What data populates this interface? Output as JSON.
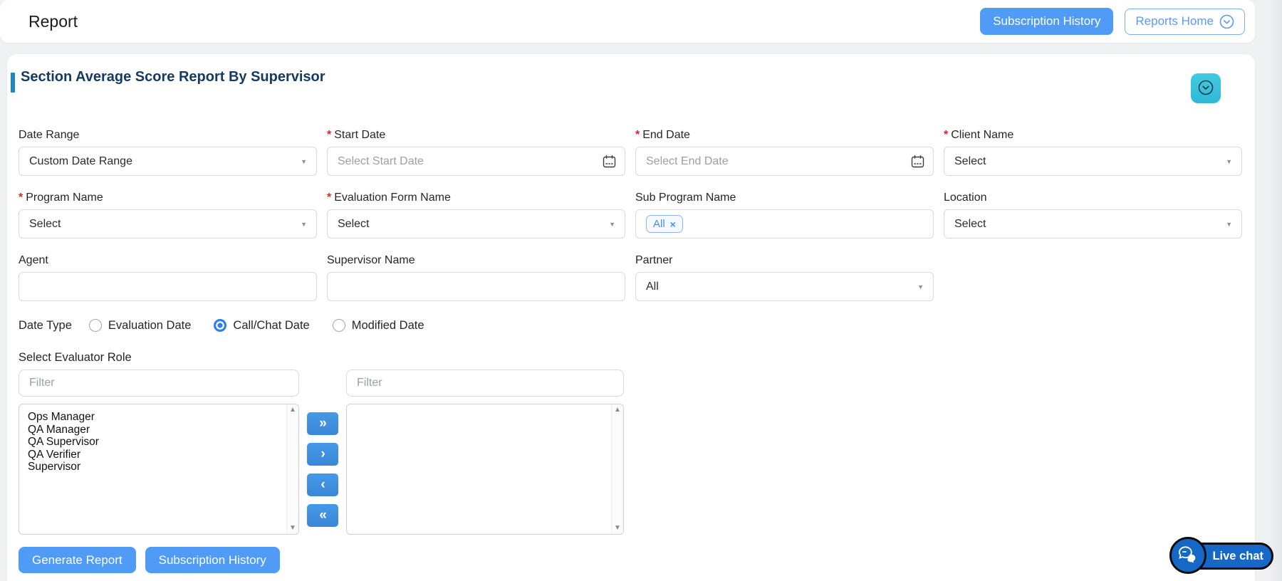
{
  "header": {
    "title": "Report",
    "subscription_history_label": "Subscription History",
    "reports_home_label": "Reports Home"
  },
  "section": {
    "title": "Section Average Score Report By Supervisor"
  },
  "misc": {
    "required_mark": "*"
  },
  "icons": {
    "select_caret": "▼",
    "scroll_up": "▲",
    "scroll_down": "▼",
    "tag_remove": "×"
  },
  "fields": {
    "date_range": {
      "label": "Date Range",
      "value": "Custom Date Range"
    },
    "start_date": {
      "label": "Start Date",
      "value": "",
      "placeholder": "Select Start Date"
    },
    "end_date": {
      "label": "End Date",
      "value": "",
      "placeholder": "Select End Date"
    },
    "client_name": {
      "label": "Client Name",
      "value": "Select"
    },
    "program_name": {
      "label": "Program Name",
      "value": "Select"
    },
    "evaluation_form_name": {
      "label": "Evaluation Form Name",
      "value": "Select"
    },
    "sub_program_name": {
      "label": "Sub Program Name",
      "tags": [
        "All"
      ]
    },
    "location": {
      "label": "Location",
      "value": "Select"
    },
    "agent": {
      "label": "Agent",
      "value": "",
      "placeholder": ""
    },
    "supervisor_name": {
      "label": "Supervisor Name",
      "value": "",
      "placeholder": ""
    },
    "partner": {
      "label": "Partner",
      "value": "All"
    }
  },
  "date_type": {
    "label": "Date Type",
    "options": [
      {
        "label": "Evaluation Date",
        "checked": false
      },
      {
        "label": "Call/Chat Date",
        "checked": true
      },
      {
        "label": "Modified Date",
        "checked": false
      }
    ]
  },
  "evaluator_role": {
    "label": "Select Evaluator Role",
    "filter_placeholder": "Filter",
    "available": [
      "Ops Manager",
      "QA Manager",
      "QA Supervisor",
      "QA Verifier",
      "Supervisor"
    ],
    "selected": [],
    "transfer_buttons": [
      "»",
      "›",
      "‹",
      "«"
    ]
  },
  "actions": {
    "generate_report": "Generate Report",
    "subscription_history": "Subscription History"
  },
  "live_chat": {
    "label": "Live chat"
  },
  "colors": {
    "primary_blue": "#4f9bf5",
    "transfer_blue": "#3f8edd",
    "accent_bar": "#1e87c2",
    "section_title": "#16395f",
    "collapse_teal": "#38c3dc",
    "required_red": "#e02121",
    "tag_blue": "#4a90f0",
    "radio_checked": "#2e7ef0",
    "livechat_blue": "#1668c7",
    "page_bg": "#eff1f3"
  }
}
